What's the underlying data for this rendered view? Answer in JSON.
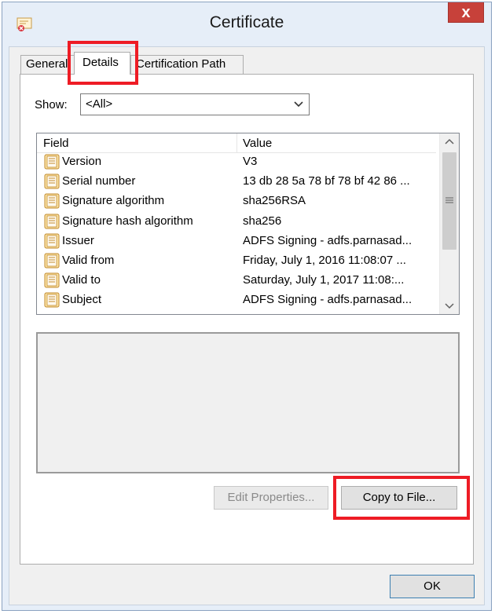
{
  "window": {
    "title": "Certificate",
    "close_label": "x",
    "icon": "certificate-icon"
  },
  "tabs": [
    {
      "label": "General",
      "selected": false
    },
    {
      "label": "Details",
      "selected": true
    },
    {
      "label": "Certification Path",
      "selected": false
    }
  ],
  "show": {
    "label": "Show:",
    "value": "<All>"
  },
  "list": {
    "columns": [
      "Field",
      "Value"
    ],
    "rows": [
      {
        "field": "Version",
        "value": "V3"
      },
      {
        "field": "Serial number",
        "value": "13 db 28 5a 78 bf 78 bf 42 86 ..."
      },
      {
        "field": "Signature algorithm",
        "value": "sha256RSA"
      },
      {
        "field": "Signature hash algorithm",
        "value": "sha256"
      },
      {
        "field": "Issuer",
        "value": "ADFS Signing - adfs.parnasad..."
      },
      {
        "field": "Valid from",
        "value": "Friday, July 1, 2016 11:08:07 ..."
      },
      {
        "field": "Valid to",
        "value": "Saturday, July 1, 2017 11:08:..."
      },
      {
        "field": "Subject",
        "value": "ADFS Signing - adfs.parnasad..."
      }
    ]
  },
  "buttons": {
    "edit_properties": "Edit Properties...",
    "copy_to_file": "Copy to File...",
    "ok": "OK"
  },
  "colors": {
    "highlight": "#ee1c25",
    "close_button": "#c7413a"
  }
}
